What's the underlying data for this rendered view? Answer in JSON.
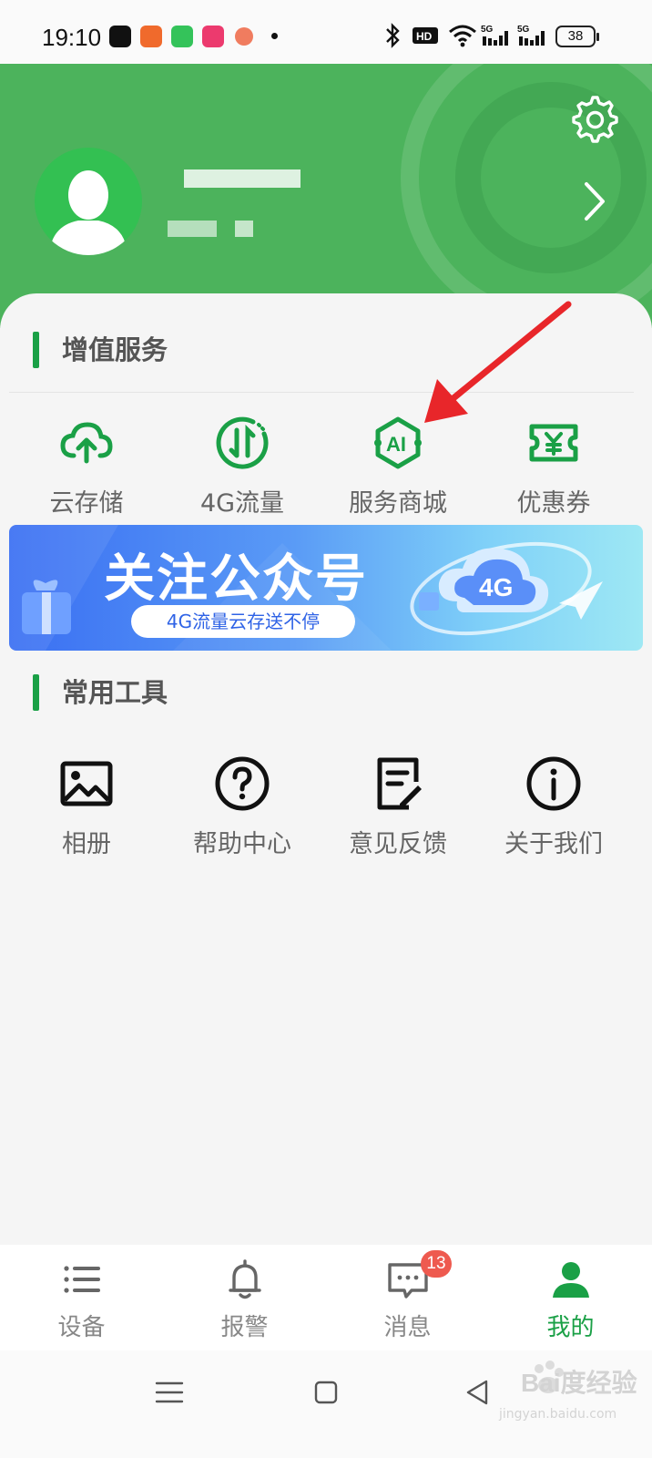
{
  "status_bar": {
    "time": "19:10",
    "battery": "38",
    "network_1": "5G",
    "network_2": "5G",
    "hd_label": "HD"
  },
  "profile": {
    "settings_icon": "gear-icon",
    "arrow_icon": "chevron-right-icon"
  },
  "value_services": {
    "title": "增值服务",
    "items": [
      {
        "label": "云存储",
        "icon": "cloud-upload-icon"
      },
      {
        "label": "4G流量",
        "icon": "data-traffic-icon"
      },
      {
        "label": "服务商城",
        "icon": "ai-mall-icon"
      },
      {
        "label": "优惠券",
        "icon": "coupon-icon"
      }
    ]
  },
  "banner": {
    "title": "关注公众号",
    "subtitle": "4G流量云存送不停",
    "badge": "4G"
  },
  "tools": {
    "title": "常用工具",
    "items": [
      {
        "label": "相册",
        "icon": "album-icon"
      },
      {
        "label": "帮助中心",
        "icon": "help-icon"
      },
      {
        "label": "意见反馈",
        "icon": "feedback-icon"
      },
      {
        "label": "关于我们",
        "icon": "info-icon"
      }
    ]
  },
  "tab_bar": {
    "tabs": [
      {
        "label": "设备",
        "icon": "device-list-icon"
      },
      {
        "label": "报警",
        "icon": "bell-icon"
      },
      {
        "label": "消息",
        "icon": "message-icon",
        "badge": "13"
      },
      {
        "label": "我的",
        "icon": "user-icon",
        "active": true
      }
    ]
  },
  "watermark": {
    "text": "Bai度经验",
    "sub": "jingyan.baidu.com"
  },
  "colors": {
    "brand_green": "#1aa046",
    "header_green": "#4cb35c",
    "badge_red": "#ee5a4f",
    "annotation_red": "#e8262a"
  }
}
